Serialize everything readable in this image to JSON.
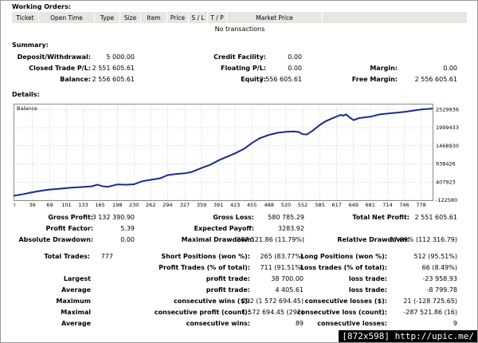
{
  "working_orders": {
    "title": "Working Orders:",
    "columns": [
      "Ticket",
      "Open Time",
      "Type",
      "Size",
      "Item",
      "Price",
      "S / L",
      "T / P",
      "Market Price"
    ],
    "empty_text": "No transactions"
  },
  "summary": {
    "title": "Summary:",
    "rows": [
      [
        [
          "Deposit/Withdrawal:",
          "5 000.00"
        ],
        [
          "Credit Facility:",
          "0.00"
        ],
        [
          "",
          ""
        ]
      ],
      [
        [
          "Closed Trade P/L:",
          "2 551 605.61"
        ],
        [
          "Floating P/L:",
          "0.00"
        ],
        [
          "Margin:",
          "0.00"
        ]
      ],
      [
        [
          "Balance:",
          "2 556 605.61"
        ],
        [
          "Equity:",
          "2 556 605.61"
        ],
        [
          "Free Margin:",
          "2 556 605.61"
        ]
      ]
    ]
  },
  "details": {
    "title": "Details:",
    "chart_label": "Balance",
    "stats": [
      [
        [
          "Gross Profit:",
          "3 132 390.90"
        ],
        [
          "Gross Loss:",
          "580 785.29"
        ],
        [
          "Total Net Profit:",
          "2 551 605.61"
        ]
      ],
      [
        [
          "Profit Factor:",
          "5.39"
        ],
        [
          "Expected Payoff:",
          "3283.92"
        ],
        [
          "",
          ""
        ]
      ],
      [
        [
          "Absolute Drawdown:",
          "0.00"
        ],
        [
          "Maximal Drawdown:",
          "287 521.86 (11.79%)"
        ],
        [
          "Relative Drawdown:",
          "27.99% (112 316.79)"
        ]
      ]
    ],
    "trades": {
      "total_label": "Total Trades:",
      "total_value": "777",
      "rows": [
        [
          "",
          "Short Positions (won %):",
          "265 (83.77%)",
          "Long Positions (won %):",
          "512 (95.51%)"
        ],
        [
          "",
          "Profit Trades (% of total):",
          "711 (91.51%)",
          "Loss trades (% of total):",
          "66 (8.49%)"
        ],
        [
          "Largest",
          "profit trade:",
          "38 700.00",
          "loss trade:",
          "-23 958.93"
        ],
        [
          "Average",
          "profit trade:",
          "4 405.61",
          "loss trade:",
          "-8 799.78"
        ],
        [
          "Maximum",
          "consecutive wins ($):",
          "292 (1 572 694.45)",
          "consecutive losses ($):",
          "21 (-128 725.65)"
        ],
        [
          "Maximal",
          "consecutive profit (count):",
          "1 572 694.45 (292)",
          "consecutive loss (count):",
          "-287 521.86 (16)"
        ],
        [
          "Average",
          "consecutive wins:",
          "89",
          "consecutive losses:",
          "9"
        ]
      ]
    }
  },
  "chart_data": {
    "type": "line",
    "title": "",
    "legend": "Balance",
    "xlabel": "",
    "ylabel": "",
    "x_ticks": [
      0,
      36,
      69,
      101,
      133,
      165,
      198,
      230,
      262,
      294,
      327,
      359,
      391,
      423,
      455,
      488,
      520,
      552,
      585,
      617,
      649,
      681,
      714,
      746,
      778
    ],
    "y_ticks": [
      -122580,
      407923,
      938426,
      1468930,
      1999433,
      2529936
    ],
    "xlim": [
      0,
      800
    ],
    "ylim": [
      -122580,
      2700000
    ],
    "colors": {
      "line": "#1b2a8f",
      "grid": "#9aa0c8"
    },
    "series": [
      {
        "name": "Balance",
        "x": [
          0,
          20,
          36,
          55,
          69,
          90,
          110,
          133,
          150,
          160,
          170,
          180,
          198,
          215,
          230,
          245,
          262,
          280,
          294,
          310,
          327,
          340,
          359,
          375,
          391,
          400,
          423,
          440,
          455,
          470,
          488,
          505,
          520,
          535,
          545,
          552,
          560,
          570,
          585,
          595,
          605,
          617,
          625,
          630,
          635,
          640,
          649,
          660,
          681,
          700,
          714,
          746,
          778,
          800
        ],
        "y": [
          5000,
          60000,
          110000,
          160000,
          190000,
          215000,
          245000,
          265000,
          285000,
          330000,
          285000,
          270000,
          340000,
          330000,
          345000,
          430000,
          475000,
          520000,
          610000,
          645000,
          665000,
          700000,
          820000,
          910000,
          1040000,
          1100000,
          1250000,
          1380000,
          1550000,
          1690000,
          1790000,
          1850000,
          1880000,
          1890000,
          1870000,
          1810000,
          1800000,
          1900000,
          2080000,
          2180000,
          2250000,
          2330000,
          2370000,
          2350000,
          2390000,
          2320000,
          2220000,
          2280000,
          2320000,
          2390000,
          2410000,
          2460000,
          2530000,
          2556605
        ]
      }
    ]
  },
  "watermark": "[872x598] http://upic.me/"
}
